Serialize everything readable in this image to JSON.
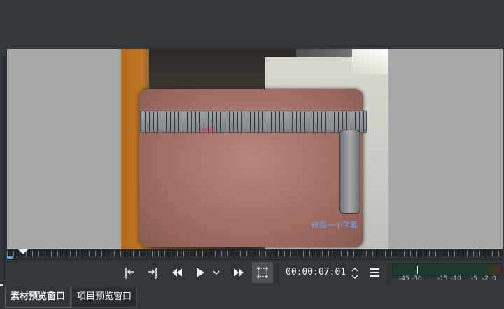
{
  "monitor": {
    "overlay_text_1": "文字",
    "overlay_text_2": "这是一个字幕"
  },
  "controls": {
    "timecode": "00:00:07:01",
    "buttons": [
      "set-zone-in",
      "set-zone-out",
      "rewind",
      "play",
      "play-options",
      "forward",
      "edit-mode",
      "menu"
    ]
  },
  "audio_meter": {
    "scale": [
      "-45",
      "-30",
      "-15",
      "-10",
      "-5",
      "-2",
      "0"
    ]
  },
  "tabs": [
    {
      "label": "素材预览窗口",
      "active": true
    },
    {
      "label": "项目预览窗口",
      "active": false
    }
  ],
  "colors": {
    "background": "#31363b",
    "monitor_bg": "#a9a9a9",
    "accent": "#3daee9",
    "overlay_red": "#e0384c",
    "overlay_blue": "#6fa8ff"
  }
}
